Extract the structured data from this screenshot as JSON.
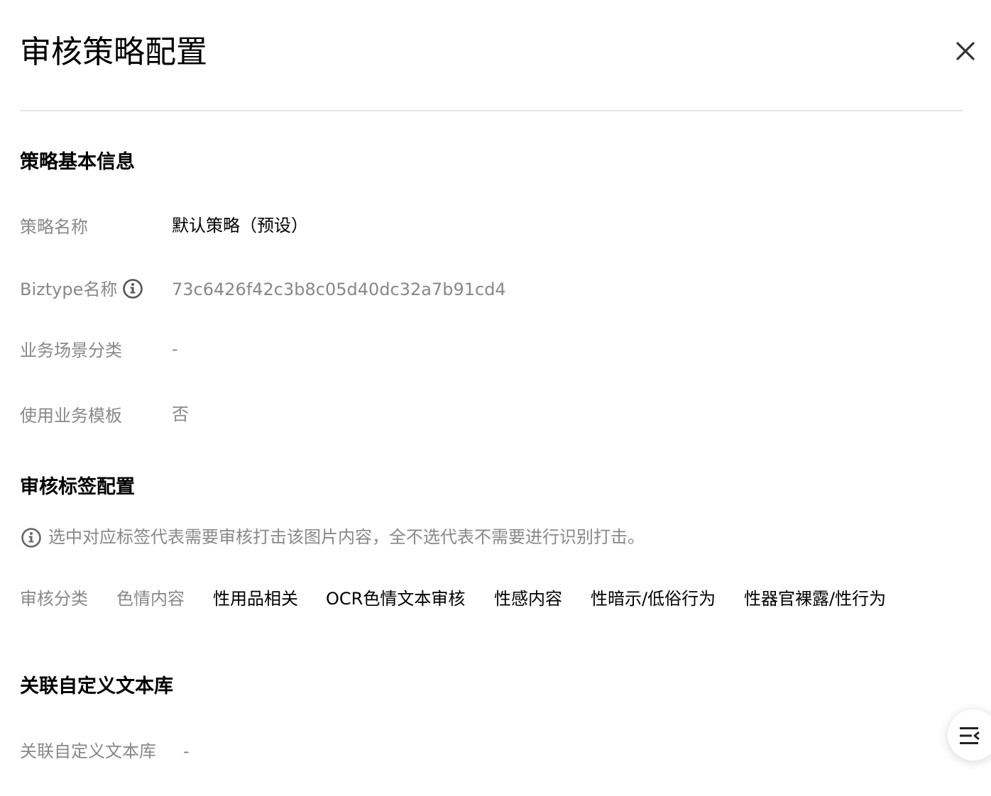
{
  "header": {
    "title": "审核策略配置"
  },
  "basic_info": {
    "section_title": "策略基本信息",
    "fields": [
      {
        "label": "策略名称",
        "value": "默认策略（预设）"
      },
      {
        "label": "Biztype名称",
        "value": "73c6426f42c3b8c05d40dc32a7b91cd4"
      },
      {
        "label": "业务场景分类",
        "value": "-"
      },
      {
        "label": "使用业务模板",
        "value": "否"
      }
    ]
  },
  "label_config": {
    "section_title": "审核标签配置",
    "hint": "选中对应标签代表需要审核打击该图片内容，全不选代表不需要进行识别打击。",
    "category_label": "审核分类",
    "categories": [
      {
        "label": "色情内容"
      },
      {
        "label": "性用品相关"
      },
      {
        "label": "OCR色情文本审核"
      },
      {
        "label": "性感内容"
      },
      {
        "label": "性暗示/低俗行为"
      },
      {
        "label": "性器官裸露/性行为"
      }
    ]
  },
  "text_library": {
    "section_title": "关联自定义文本库",
    "label": "关联自定义文本库",
    "value": "-"
  },
  "colors": {
    "label_gray": "#888888",
    "text_dark": "#000000",
    "divider": "#e6e6e6"
  },
  "icons": {
    "close": "close-icon",
    "info": "info-icon",
    "menu_collapse": "menu-collapse-icon"
  }
}
